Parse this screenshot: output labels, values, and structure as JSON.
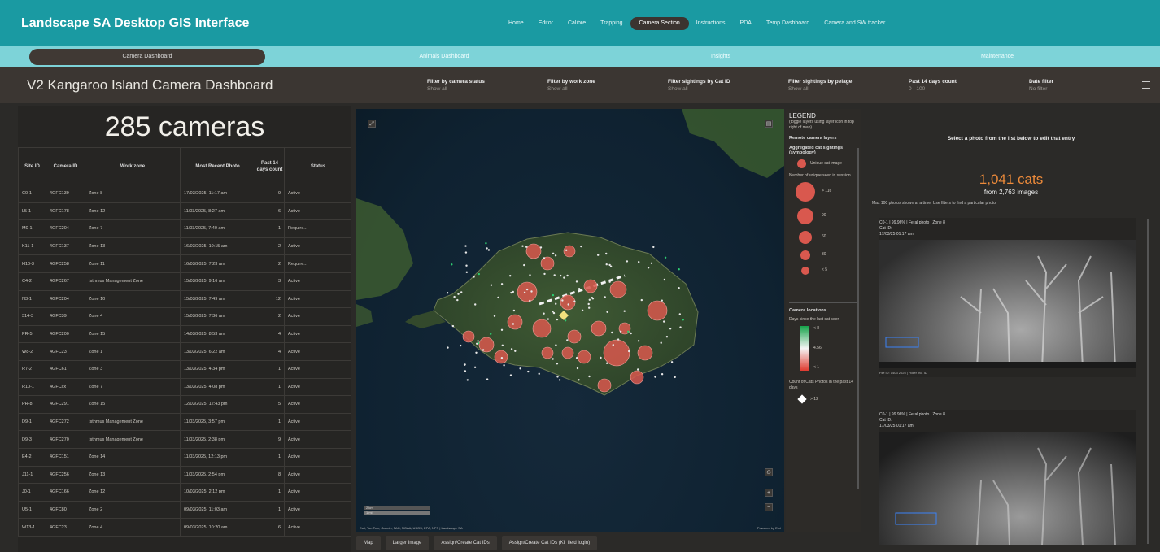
{
  "app_title": "Landscape SA Desktop GIS Interface",
  "nav": [
    "Home",
    "Editor",
    "Calibre",
    "Trapping",
    "Camera Section",
    "Instructions",
    "PDA",
    "Temp Dashboard",
    "Camera and SW tracker"
  ],
  "nav_active": "Camera Section",
  "subnav": [
    "Camera Dashboard",
    "Animals Dashboard",
    "Insights",
    "Maintenance"
  ],
  "subnav_active": "Camera Dashboard",
  "page_title": "V2 Kangaroo Island Camera Dashboard",
  "filters": [
    {
      "label": "Filter by camera status",
      "value": "Show all"
    },
    {
      "label": "Filter by work zone",
      "value": "Show all"
    },
    {
      "label": "Filter sightings by Cat ID",
      "value": "Show all"
    },
    {
      "label": "Filter sightings by pelage",
      "value": "Show all"
    },
    {
      "label": "Past 14 days count",
      "value": "0 - 100"
    },
    {
      "label": "Date filter",
      "value": "No filter"
    }
  ],
  "camera_count": "285 cameras",
  "table": {
    "headers": [
      "Site ID",
      "Camera ID",
      "Work zone",
      "Most Recent Photo",
      "Past 14 days count",
      "Status"
    ],
    "rows": [
      [
        "C0-1",
        "4GFC139",
        "Zone 8",
        "17/03/2025, 11:17 am",
        "9",
        "Active"
      ],
      [
        "L5-1",
        "4GFC178",
        "Zone 12",
        "11/03/2025, 8:27 am",
        "6",
        "Active"
      ],
      [
        "M0-1",
        "4GFC204",
        "Zone 7",
        "11/03/2025, 7:40 am",
        "1",
        "Require..."
      ],
      [
        "K11-1",
        "4GFC137",
        "Zone 13",
        "16/03/2025, 10:15 am",
        "2",
        "Active"
      ],
      [
        "H10-3",
        "4GFC258",
        "Zone 11",
        "16/03/2025, 7:23 am",
        "2",
        "Require..."
      ],
      [
        "C4-2",
        "4GFC267",
        "Isthmus Management Zone",
        "15/03/2025, 9:16 am",
        "3",
        "Active"
      ],
      [
        "N3-1",
        "4GFC204",
        "Zone 10",
        "15/03/2025, 7:49 am",
        "12",
        "Active"
      ],
      [
        "314-3",
        "4GFC39",
        "Zone 4",
        "15/03/2025, 7:36 am",
        "2",
        "Active"
      ],
      [
        "PR-5",
        "4GFC200",
        "Zone 15",
        "14/03/2025, 8:53 am",
        "4",
        "Active"
      ],
      [
        "W8-2",
        "4GFC23",
        "Zone 1",
        "13/03/2025, 6:22 am",
        "4",
        "Active"
      ],
      [
        "R7-2",
        "4GFC61",
        "Zone 3",
        "13/03/2025, 4:34 pm",
        "1",
        "Active"
      ],
      [
        "R10-1",
        "4GFCxx",
        "Zone 7",
        "13/03/2025, 4:08 pm",
        "1",
        "Active"
      ],
      [
        "PR-8",
        "4GFC291",
        "Zone 15",
        "12/03/2025, 12:43 pm",
        "5",
        "Active"
      ],
      [
        "D9-1",
        "4GFC272",
        "Isthmus Management Zone",
        "11/03/2025, 3:57 pm",
        "1",
        "Active"
      ],
      [
        "D9-3",
        "4GFC270",
        "Isthmus Management Zone",
        "11/03/2025, 2:38 pm",
        "9",
        "Active"
      ],
      [
        "E4-2",
        "4GFC151",
        "Zone 14",
        "11/03/2025, 12:13 pm",
        "1",
        "Active"
      ],
      [
        "J11-1",
        "4GFC256",
        "Zone 13",
        "11/03/2025, 2:54 pm",
        "8",
        "Active"
      ],
      [
        "J0-1",
        "4GFC166",
        "Zone 12",
        "10/03/2025, 2:12 pm",
        "1",
        "Active"
      ],
      [
        "U5-1",
        "4GFC80",
        "Zone 2",
        "09/03/2025, 11:03 am",
        "1",
        "Active"
      ],
      [
        "W13-1",
        "4GFC23",
        "Zone 4",
        "09/03/2025, 10:20 am",
        "6",
        "Active"
      ]
    ]
  },
  "legend": {
    "title": "LEGEND",
    "subtitle": "(toggle layers using layer icon in top right of map)",
    "remote_layers": "Remote camera layers",
    "aggregated": "Aggregated cat sightings (symbology)",
    "unique_cat_image": "Unique cat image",
    "unique_seen": "Number of unique seen in session",
    "size_labels": [
      "> 116",
      "90",
      "60",
      "30",
      "< 5"
    ],
    "camera_locations": "Camera locations",
    "days_since": "Days since the last cat seen",
    "gradient_labels": [
      "< 8",
      "4.56",
      "< 1"
    ],
    "count_photos": "Count of Cats Photos in the past 14 days",
    "diamond_label": "> 12"
  },
  "map": {
    "attribution": "Esri, TomTom, Garmin, FAO, NOAA, USGS, EPA, NPS | Landscape SA",
    "powered": "Powered by Esri",
    "scale": [
      "2 km",
      "1 mi"
    ]
  },
  "bottom_buttons": [
    "Map",
    "Larger Image",
    "Assign/Create Cat IDs",
    "Assign/Create Cat IDs (KI_field login)"
  ],
  "right": {
    "select_msg": "Select a photo from the list below to edit that entry",
    "cats_count": "1,041 cats",
    "images_sub": "from 2,763 images",
    "max_msg": "Max 100 photos shown at a time. Use filters to find a particular photo",
    "photos": [
      {
        "line1": "C0-1 | 99.96% | Feral photo | Zone 8",
        "line2": "Cat ID:",
        "line3": "17/03/25 01:17 am",
        "foot": "File ID: 1403 2025 | Fidler Inc. ID"
      },
      {
        "line1": "C0-1 | 99.96% | Feral photo | Zone 8",
        "line2": "Cat ID:",
        "line3": "17/03/25 01:17 am",
        "foot": ""
      }
    ]
  },
  "colors": {
    "topbar": "#1a9aa2",
    "subbar": "#7dd3d8",
    "accent_orange": "#ec8a3a",
    "cluster": "#d9584e"
  }
}
